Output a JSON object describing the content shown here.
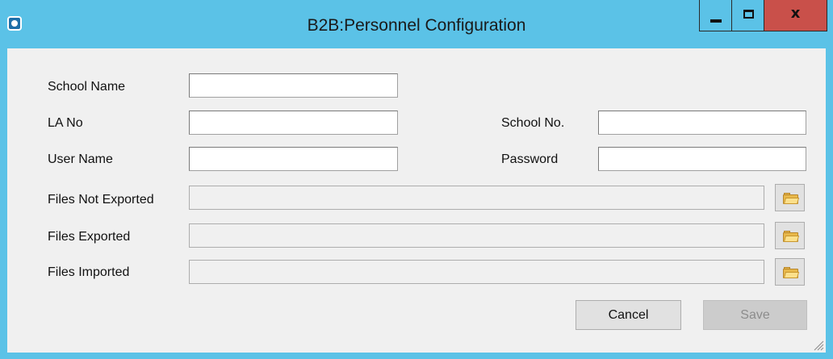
{
  "window": {
    "title": "B2B:Personnel Configuration",
    "controls": {
      "minimize_icon": "minimize-icon",
      "maximize_icon": "maximize-icon",
      "close_icon": "close-icon",
      "close_glyph": "x"
    },
    "colors": {
      "titlebar": "#5bc2e7",
      "close_button": "#c9504a",
      "client": "#f0f0f0"
    }
  },
  "form": {
    "school_name": {
      "label": "School Name",
      "value": ""
    },
    "la_no": {
      "label": "LA No",
      "value": ""
    },
    "school_no": {
      "label": "School No.",
      "value": ""
    },
    "user_name": {
      "label": "User Name",
      "value": ""
    },
    "password": {
      "label": "Password",
      "value": ""
    },
    "files_not_exported": {
      "label": "Files Not Exported",
      "value": ""
    },
    "files_exported": {
      "label": "Files Exported",
      "value": ""
    },
    "files_imported": {
      "label": "Files Imported",
      "value": ""
    }
  },
  "buttons": {
    "cancel": "Cancel",
    "save": "Save",
    "browse_icon": "folder-icon"
  }
}
